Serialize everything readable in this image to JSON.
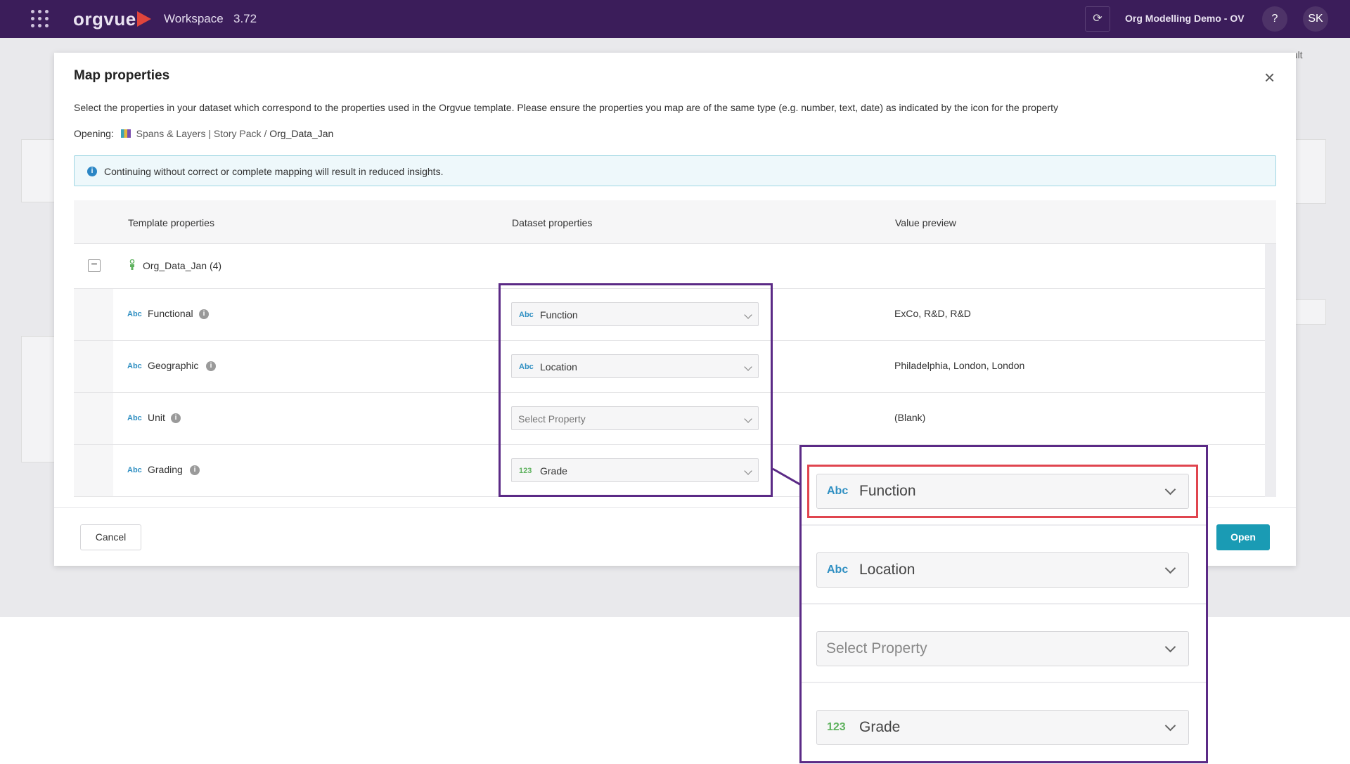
{
  "topbar": {
    "brand": "orgvue",
    "workspace_label": "Workspace",
    "workspace_version": "3.72",
    "org_name": "Org Modelling Demo - OV",
    "help_label": "?",
    "user_initials": "SK",
    "brand_color": "#3b1d5a"
  },
  "background": {
    "default_label": "ault"
  },
  "modal": {
    "title": "Map properties",
    "description": "Select the properties in your dataset which correspond to the properties used in the Orgvue template. Please ensure the properties you map are of the same type (e.g. number, text, date) as indicated by the icon for the property",
    "opening_label": "Opening:",
    "opening_pack": "Spans & Layers | Story Pack",
    "opening_sep": "/",
    "opening_dataset": "Org_Data_Jan",
    "alert_text": "Continuing without correct or complete mapping will result in reduced insights.",
    "headers": {
      "template": "Template properties",
      "dataset": "Dataset properties",
      "preview": "Value preview"
    },
    "group_label": "Org_Data_Jan (4)",
    "rows": [
      {
        "type": "Abc",
        "name": "Functional",
        "mapped_type": "Abc",
        "mapped": "Function",
        "preview": "ExCo, R&D, R&D"
      },
      {
        "type": "Abc",
        "name": "Geographic",
        "mapped_type": "Abc",
        "mapped": "Location",
        "preview": "Philadelphia, London, London"
      },
      {
        "type": "Abc",
        "name": "Unit",
        "mapped_type": "",
        "mapped": "Select Property",
        "preview": "(Blank)"
      },
      {
        "type": "Abc",
        "name": "Grading",
        "mapped_type": "123",
        "mapped": "Grade",
        "preview": ""
      }
    ],
    "cancel_label": "Cancel",
    "open_label": "Open",
    "accent_color": "#1a9bb4"
  },
  "zoom": {
    "items": [
      {
        "type": "Abc",
        "value": "Function"
      },
      {
        "type": "Abc",
        "value": "Location"
      },
      {
        "type": "",
        "value": "Select Property"
      },
      {
        "type": "123",
        "value": "Grade"
      }
    ],
    "callout_color": "#5b2a86",
    "highlight_color": "#e0454f"
  }
}
